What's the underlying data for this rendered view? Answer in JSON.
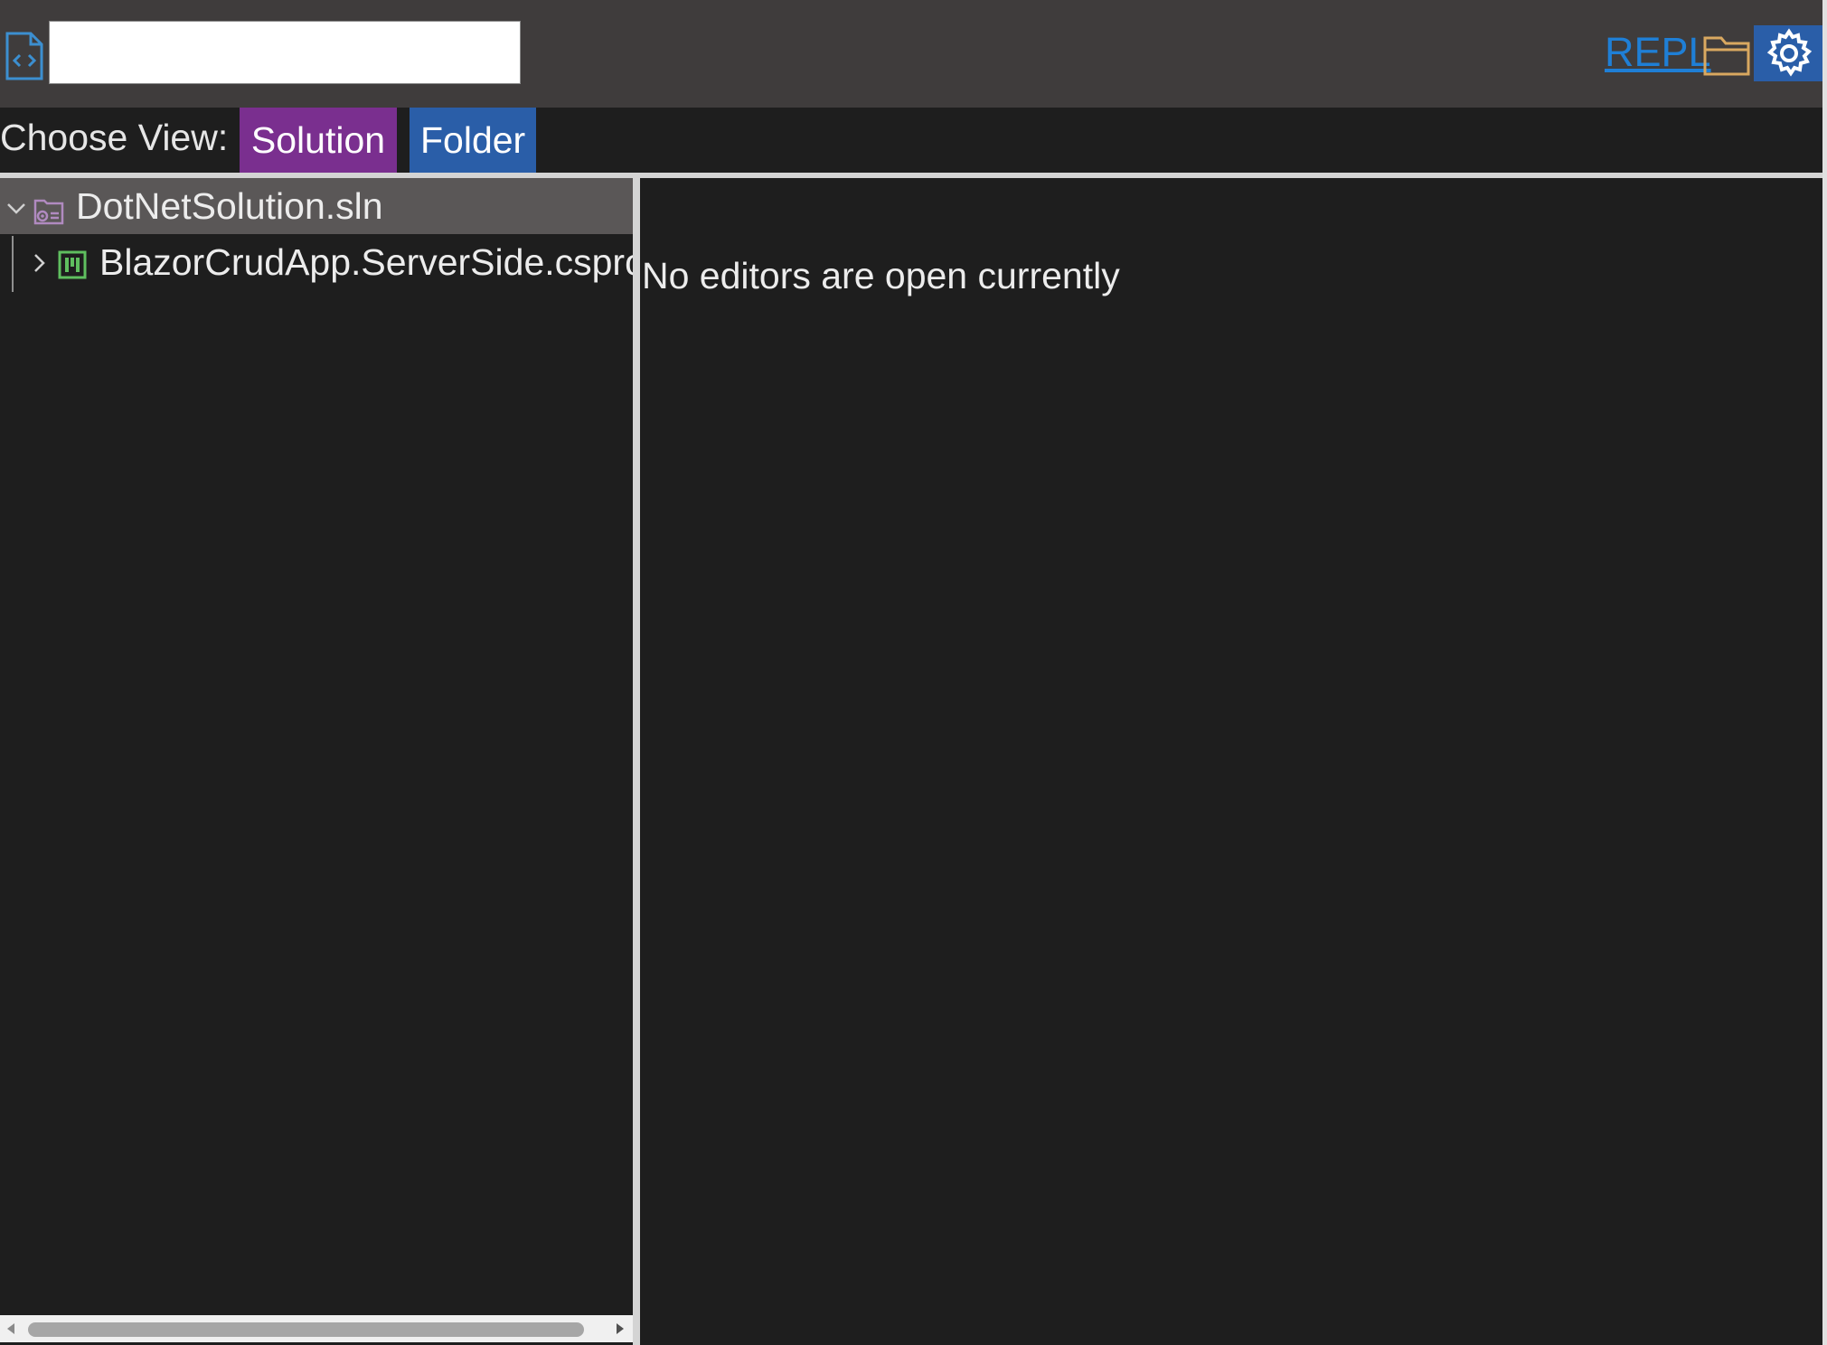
{
  "header": {
    "search": {
      "value": "",
      "placeholder": ""
    },
    "repl_label": "REPL",
    "icons": {
      "file": "code-file-icon",
      "folder": "folder-icon",
      "settings": "gear-icon"
    }
  },
  "view_chooser": {
    "label": "Choose View:",
    "options": [
      {
        "label": "Solution",
        "color": "#7a2f8f"
      },
      {
        "label": "Folder",
        "color": "#2a5ea8"
      }
    ]
  },
  "tree": {
    "solution": {
      "label": "DotNetSolution.sln",
      "expanded": true,
      "icon": "solution-icon"
    },
    "projects": [
      {
        "label": "BlazorCrudApp.ServerSide.csproj",
        "expanded": false,
        "icon": "csharp-project-icon"
      }
    ]
  },
  "editor": {
    "empty_message": "No editors are open currently"
  }
}
